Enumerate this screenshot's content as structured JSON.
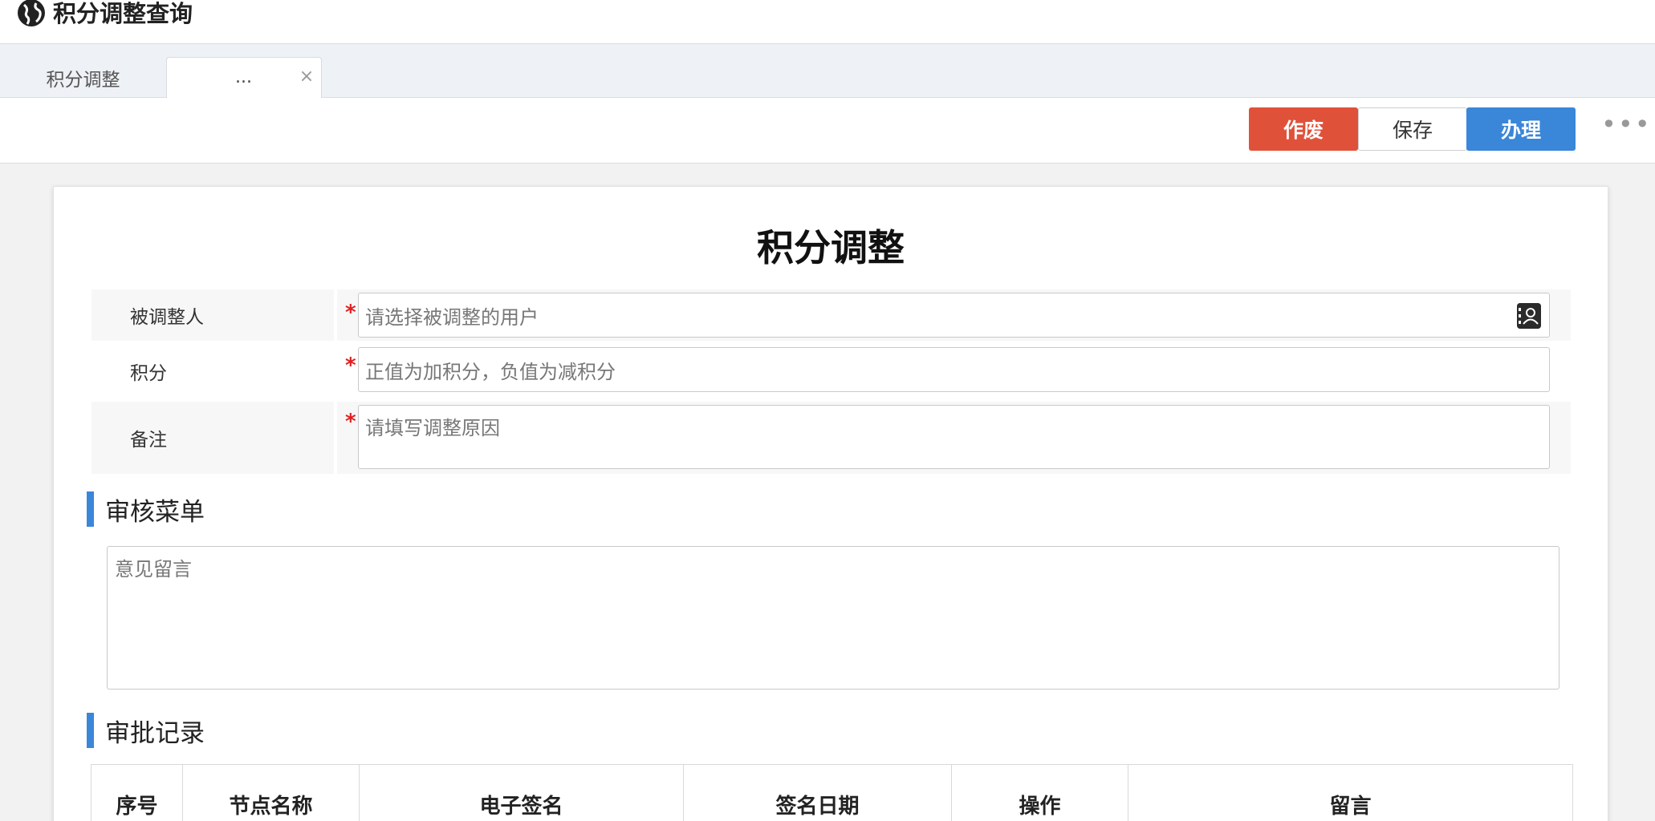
{
  "app": {
    "title": "积分调整查询",
    "icon": "globe-icon"
  },
  "tabs": [
    {
      "label": "积分调整",
      "active": false
    },
    {
      "label": "...",
      "active": true,
      "closable": true,
      "close_glyph": "×"
    }
  ],
  "toolbar": {
    "void_label": "作废",
    "save_label": "保存",
    "handle_label": "办理",
    "more_glyph": "•••"
  },
  "colors": {
    "void_button": "#e0513a",
    "handle_button": "#3a86d9",
    "section_accent": "#3a86d9",
    "required_mark": "#e02020"
  },
  "form": {
    "title": "积分调整",
    "required_mark": "*",
    "fields": [
      {
        "label": "被调整人",
        "placeholder": "请选择被调整的用户",
        "required": true,
        "icon": "contact-card-icon"
      },
      {
        "label": "积分",
        "placeholder": "正值为加积分，负值为减积分",
        "required": true
      },
      {
        "label": "备注",
        "placeholder": "请填写调整原因",
        "required": true
      }
    ]
  },
  "review": {
    "heading": "审核菜单",
    "opinion_placeholder": "意见留言"
  },
  "approval": {
    "heading": "审批记录",
    "columns": [
      "序号",
      "节点名称",
      "电子签名",
      "签名日期",
      "操作",
      "留言"
    ]
  }
}
